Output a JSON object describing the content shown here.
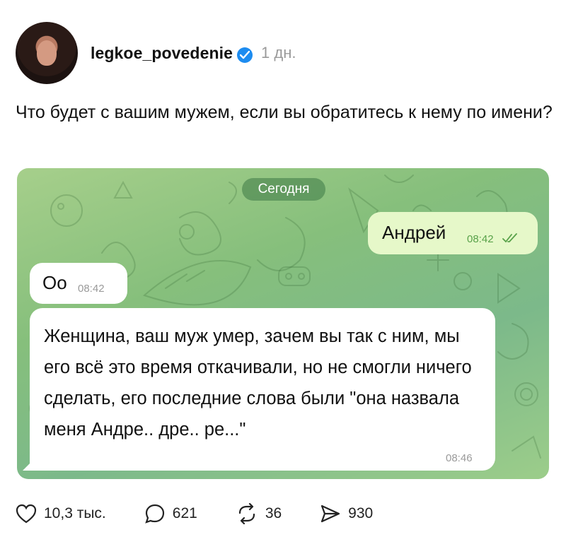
{
  "post": {
    "author": "legkoe_povedenie",
    "time": "1 дн.",
    "caption": "Что будет с вашим мужем, если вы обратитесь к нему по имени?"
  },
  "chat": {
    "date_label": "Сегодня",
    "messages": [
      {
        "direction": "out",
        "text": "Андрей",
        "time": "08:42"
      },
      {
        "direction": "in",
        "text": "Оо",
        "time": "08:42"
      },
      {
        "direction": "in",
        "text": "Женщина, ваш муж умер, зачем вы так с ним, мы его всё это время откачивали, но не смогли ничего сделать, его последние слова были \"она назвала меня Андре.. дре.. ре...\"",
        "time": "08:46"
      }
    ]
  },
  "actions": {
    "likes": "10,3 тыс.",
    "comments": "621",
    "reposts": "36",
    "shares": "930"
  },
  "icons": {
    "verified": "verified-badge-icon",
    "like": "heart-icon",
    "comment": "comment-bubble-icon",
    "repost": "repost-icon",
    "share": "send-icon"
  },
  "colors": {
    "verified": "#1d8cf0",
    "outgoing_bubble": "#e6f8c9",
    "chat_background": "#86bf7c"
  }
}
